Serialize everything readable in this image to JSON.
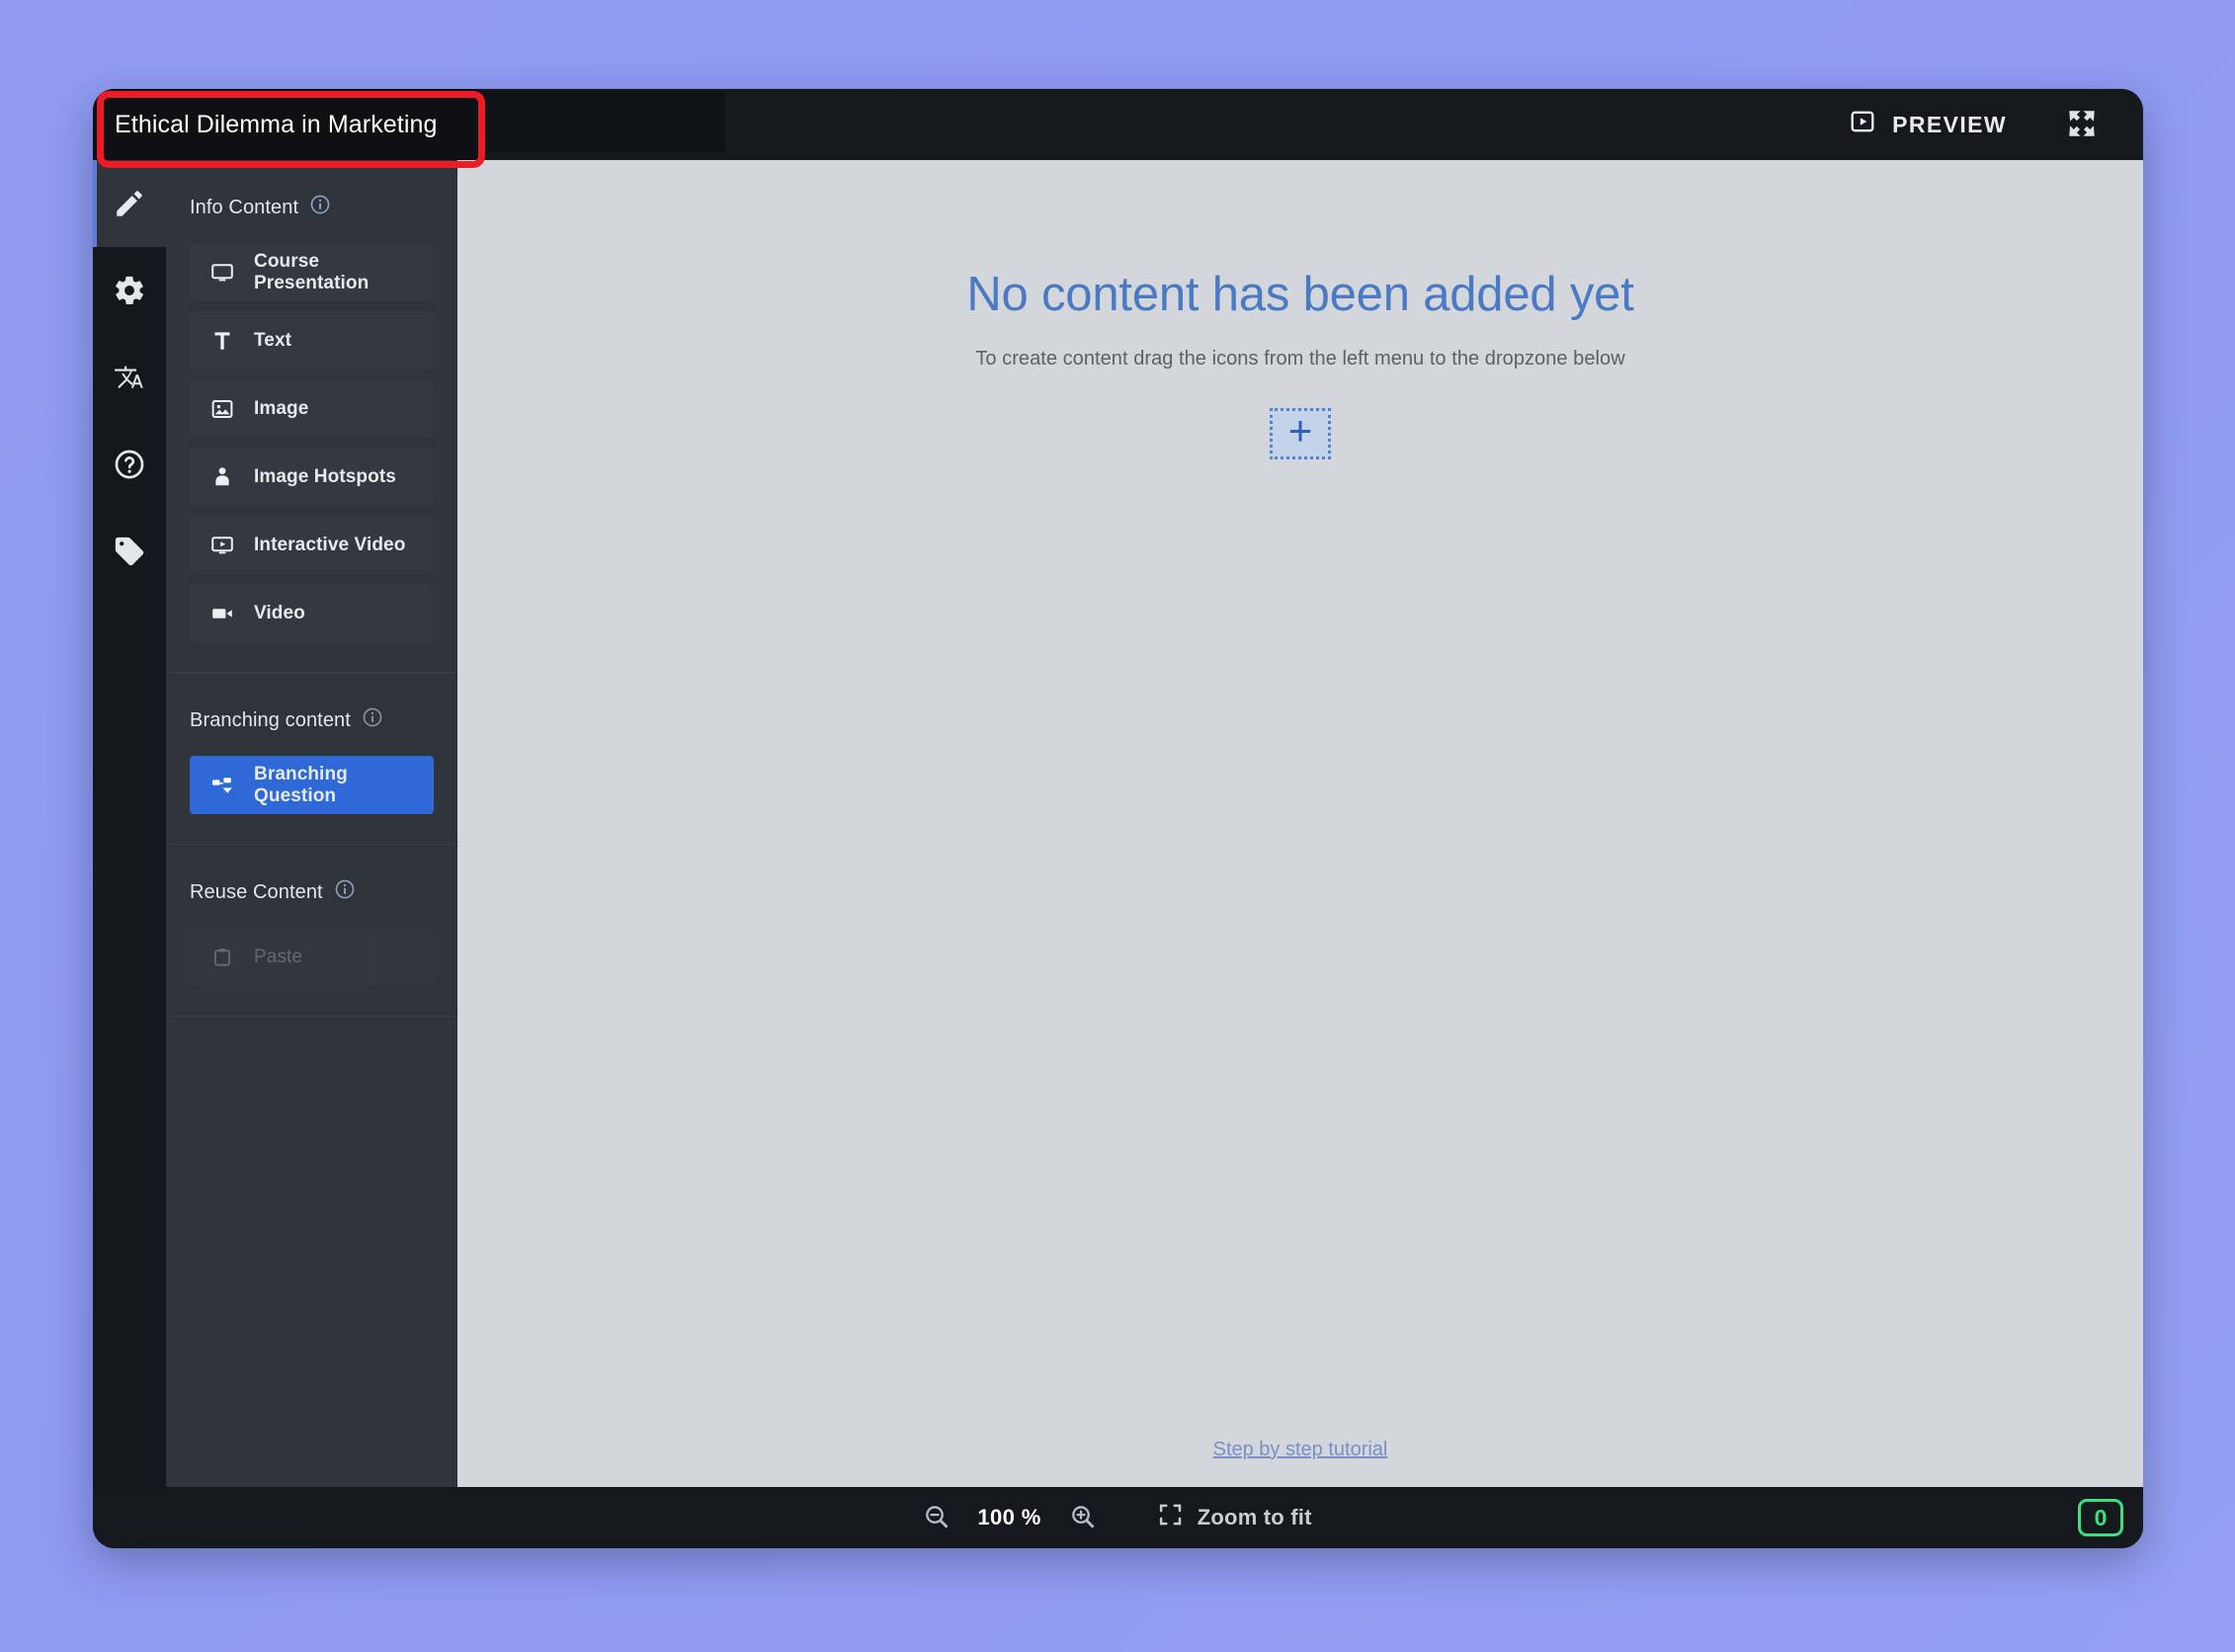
{
  "header": {
    "title_value": "Ethical Dilemma in Marketing",
    "title_placeholder": "Title",
    "preview_label": "PREVIEW",
    "preview_icon": "play-box-icon",
    "fullscreen_icon": "fullscreen-expand-icon"
  },
  "rail": {
    "items": [
      {
        "name": "edit",
        "icon": "pencil-icon",
        "active": true
      },
      {
        "name": "settings",
        "icon": "gear-icon",
        "active": false
      },
      {
        "name": "translations",
        "icon": "translate-icon",
        "active": false
      },
      {
        "name": "help",
        "icon": "question-circle-icon",
        "active": false
      },
      {
        "name": "metadata",
        "icon": "tag-icon",
        "active": false
      }
    ]
  },
  "sidebar": {
    "sections": [
      {
        "title": "Info Content",
        "info_icon": "info-circle-icon",
        "items": [
          {
            "label": "Course Presentation",
            "icon": "presentation-icon",
            "style": "normal"
          },
          {
            "label": "Text",
            "icon": "text-t-icon",
            "style": "normal"
          },
          {
            "label": "Image",
            "icon": "image-icon",
            "style": "normal"
          },
          {
            "label": "Image Hotspots",
            "icon": "hotspot-pin-icon",
            "style": "normal"
          },
          {
            "label": "Interactive Video",
            "icon": "interactive-video-icon",
            "style": "normal"
          },
          {
            "label": "Video",
            "icon": "video-camera-icon",
            "style": "normal"
          }
        ]
      },
      {
        "title": "Branching content",
        "info_icon": "info-circle-icon",
        "items": [
          {
            "label": "Branching Question",
            "icon": "branching-icon",
            "style": "primary"
          }
        ]
      },
      {
        "title": "Reuse Content",
        "info_icon": "info-circle-icon",
        "items": [
          {
            "label": "Paste",
            "icon": "clipboard-paste-icon",
            "style": "disabled"
          }
        ]
      }
    ]
  },
  "canvas": {
    "empty_title": "No content has been added yet",
    "empty_subtitle": "To create content drag the icons from the left menu to the dropzone below",
    "dropzone_glyph": "+",
    "tutorial_link": "Step by step tutorial"
  },
  "footer": {
    "zoom_out_icon": "zoom-out-icon",
    "zoom_level": "100 %",
    "zoom_in_icon": "zoom-in-icon",
    "zoom_to_fit_label": "Zoom to fit",
    "zoom_to_fit_icon": "fit-frame-icon",
    "counter_value": "0"
  },
  "colors": {
    "accent_blue": "#2f69d8",
    "canvas_heading_blue": "#4a7ac4",
    "annotation_red": "#ec1c24",
    "counter_green": "#3ce07e",
    "panel_dark": "#2f333a",
    "window_dark": "#15181d",
    "canvas_gray": "#d3d6da"
  }
}
